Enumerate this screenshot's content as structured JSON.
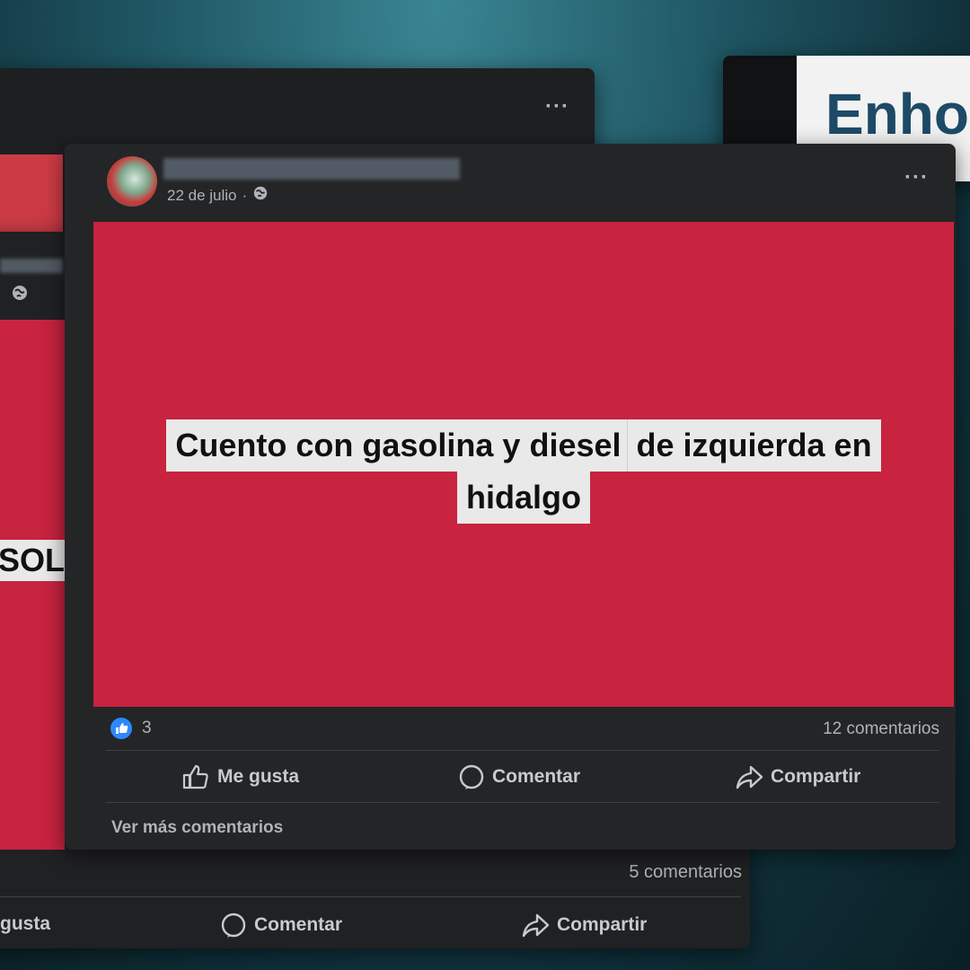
{
  "right_card": {
    "headline_fragment": "Enho"
  },
  "back_card": {
    "image_text_fragment": "SOL",
    "comment_count": "5 comentarios",
    "like_label_fragment": "gusta",
    "comment_label": "Comentar",
    "share_label": "Compartir"
  },
  "main_post": {
    "date": "22 de julio",
    "image": {
      "line1_part1": "Cuento con gasolina y diesel",
      "line1_part2": "de izquierda en",
      "line2": "hidalgo",
      "bg_color": "#c8233f"
    },
    "reaction_count": "3",
    "comment_count": "12 comentarios",
    "actions": {
      "like": "Me gusta",
      "comment": "Comentar",
      "share": "Compartir"
    },
    "more_comments": "Ver más comentarios"
  }
}
